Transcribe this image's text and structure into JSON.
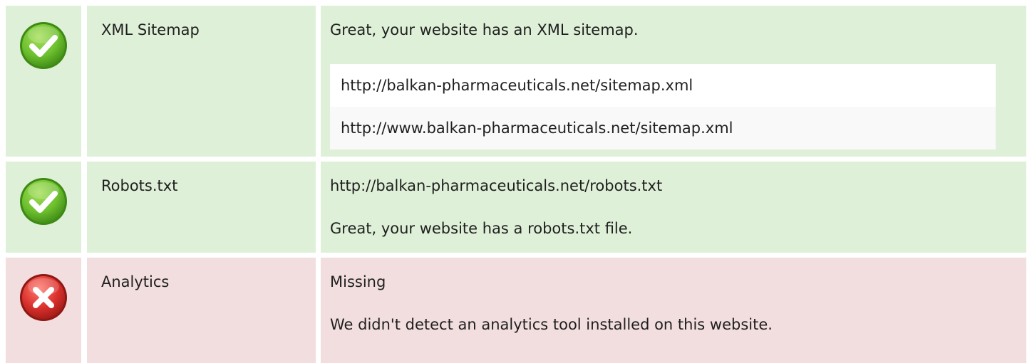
{
  "rows": [
    {
      "status": "pass",
      "status_icon": "check-circle-icon",
      "label": "XML Sitemap",
      "message": "Great, your website has an XML sitemap.",
      "urls": [
        "http://balkan-pharmaceuticals.net/sitemap.xml",
        "http://www.balkan-pharmaceuticals.net/sitemap.xml"
      ]
    },
    {
      "status": "pass",
      "status_icon": "check-circle-icon",
      "label": "Robots.txt",
      "url": "http://balkan-pharmaceuticals.net/robots.txt",
      "message": "Great, your website has a robots.txt file."
    },
    {
      "status": "fail",
      "status_icon": "error-circle-icon",
      "label": "Analytics",
      "value": "Missing",
      "message": "We didn't detect an analytics tool installed on this website."
    }
  ],
  "colors": {
    "pass_bg": "#dff0d8",
    "fail_bg": "#f2dede",
    "pass_icon": "#6cbf2d",
    "fail_icon": "#d9302c"
  }
}
